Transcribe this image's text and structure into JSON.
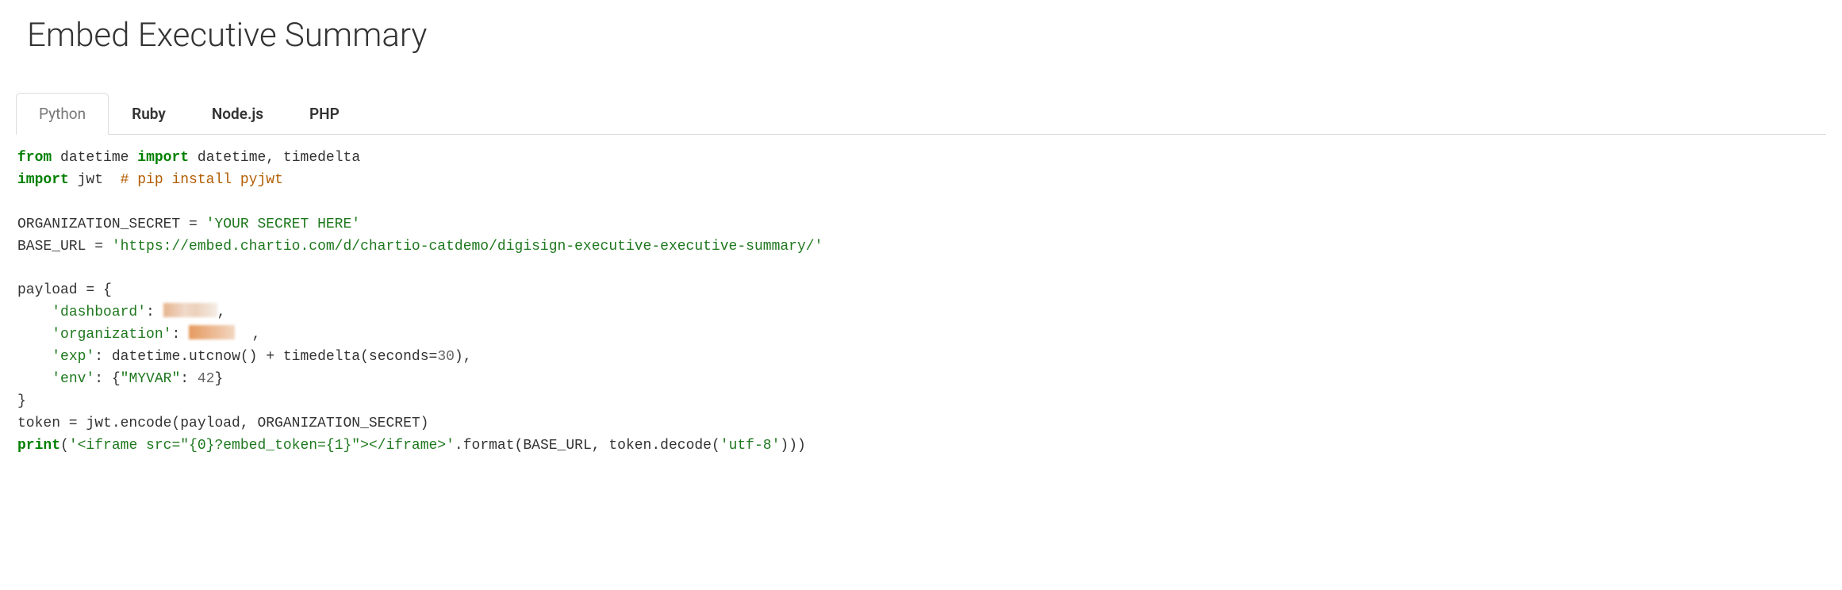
{
  "title": "Embed Executive Summary",
  "tabs": {
    "python": "Python",
    "ruby": "Ruby",
    "nodejs": "Node.js",
    "php": "PHP"
  },
  "code": {
    "line1_from": "from",
    "line1_mod": "datetime",
    "line1_import": "import",
    "line1_names": "datetime, timedelta",
    "line2_import": "import",
    "line2_mod": "jwt",
    "line2_comment": "# pip install pyjwt",
    "org_secret_var": "ORGANIZATION_SECRET = ",
    "org_secret_val": "'YOUR SECRET HERE'",
    "base_url_var": "BASE_URL = ",
    "base_url_val": "'https://embed.chartio.com/d/chartio-catdemo/digisign-executive-executive-summary/'",
    "payload_open": "payload = {",
    "dash_key": "'dashboard'",
    "dash_colon": ": ",
    "dash_comma": ",",
    "org_key": "'organization'",
    "org_colon": ": ",
    "org_comma": ",",
    "exp_key": "'exp'",
    "exp_val": ": datetime.utcnow() + timedelta(seconds=",
    "exp_num": "30",
    "exp_close": "),",
    "env_key": "'env'",
    "env_colon": ": {",
    "env_myvar": "\"MYVAR\"",
    "env_colon2": ": ",
    "env_num": "42",
    "env_close": "}",
    "payload_close": "}",
    "token_line": "token = jwt.encode(payload, ORGANIZATION_SECRET)",
    "print_kw": "print",
    "print_open": "(",
    "print_str": "'<iframe src=\"{0}?embed_token={1}\"></iframe>'",
    "print_rest": ".format(BASE_URL, token.decode(",
    "print_utf": "'utf-8'",
    "print_close": ")))"
  }
}
